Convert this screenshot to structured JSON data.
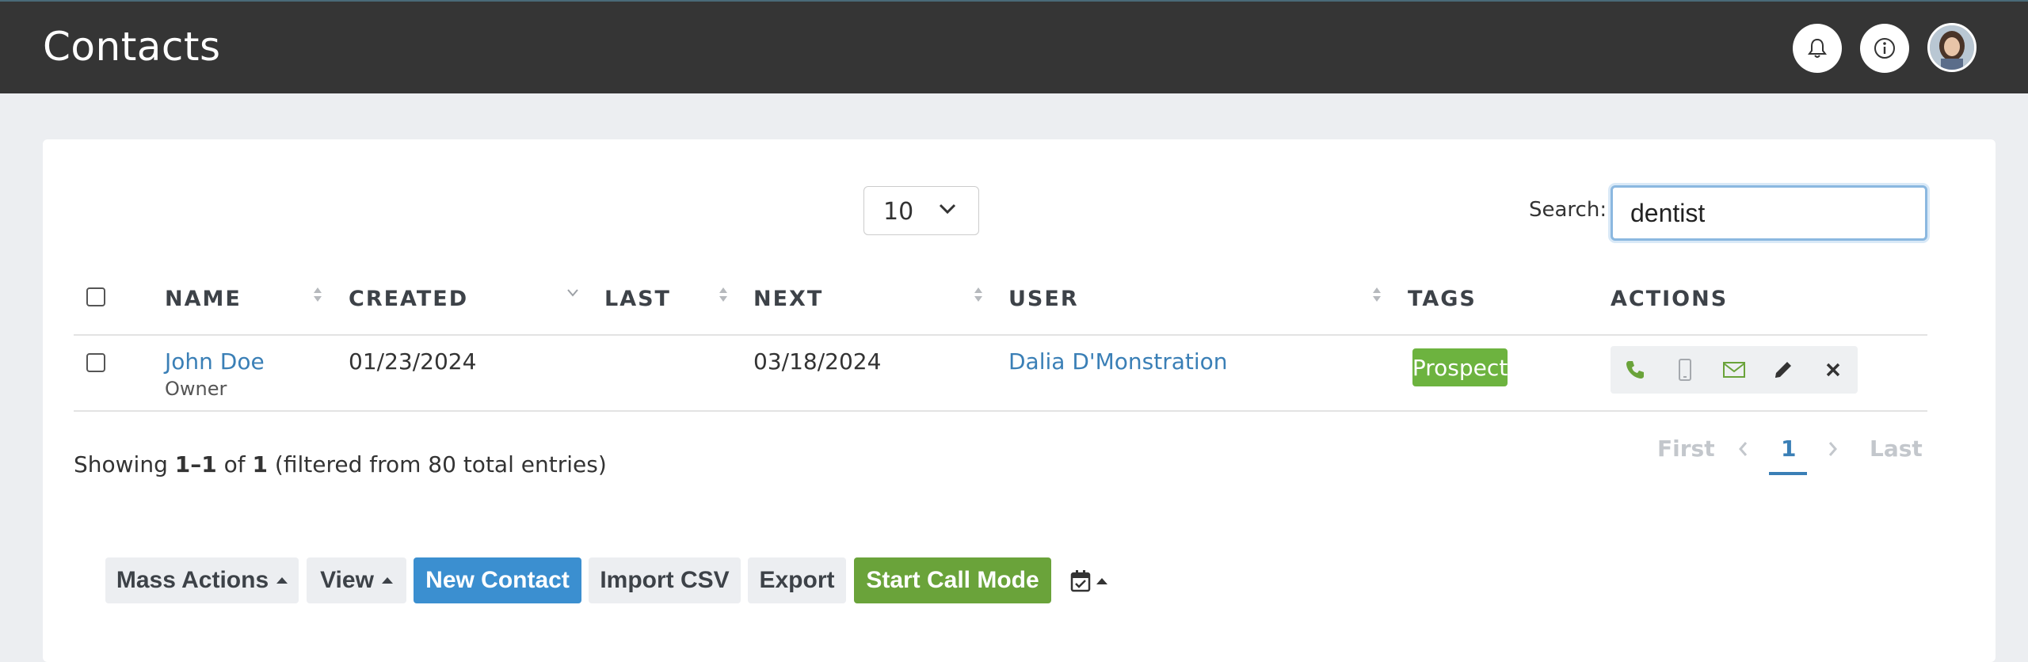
{
  "header": {
    "title": "Contacts",
    "icons": [
      "bell-icon",
      "info-icon",
      "avatar"
    ]
  },
  "toolbar": {
    "page_length": "10",
    "search_label": "Search:",
    "search_value": "dentist"
  },
  "table": {
    "columns": [
      "NAME",
      "CREATED",
      "LAST",
      "NEXT",
      "USER",
      "TAGS",
      "ACTIONS"
    ],
    "rows": [
      {
        "name": "John Doe",
        "role": "Owner",
        "created": "01/23/2024",
        "last": "",
        "next": "03/18/2024",
        "user": "Dalia D'Monstration",
        "tag": "Prospect",
        "actions": [
          "phone-icon",
          "mobile-icon",
          "email-icon",
          "edit-icon",
          "delete-icon"
        ]
      }
    ]
  },
  "footer": {
    "showing_prefix": "Showing ",
    "showing_range": "1–1",
    "showing_of": " of ",
    "showing_count": "1",
    "showing_suffix": " (filtered from 80 total entries)",
    "pagination": {
      "first": "First",
      "current": "1",
      "last": "Last"
    }
  },
  "buttons": {
    "mass_actions": "Mass Actions",
    "view": "View",
    "new_contact": "New Contact",
    "import_csv": "Import CSV",
    "export": "Export",
    "start_call_mode": "Start Call Mode"
  },
  "colors": {
    "topbar": "#353535",
    "link": "#3a7fb6",
    "tag": "#6db33f",
    "new_contact": "#3b8fd0",
    "start_call": "#6aa33a"
  }
}
